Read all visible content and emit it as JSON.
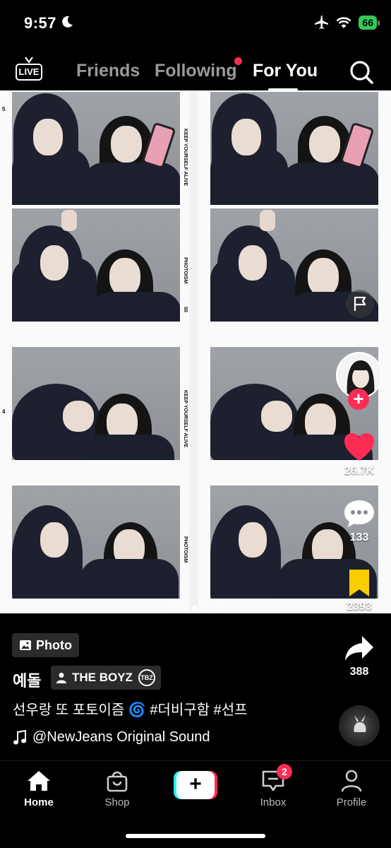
{
  "status_bar": {
    "time": "9:57",
    "battery": "66"
  },
  "top_nav": {
    "live_label": "LIVE",
    "tabs": [
      {
        "label": "Friends"
      },
      {
        "label": "Following"
      },
      {
        "label": "For You"
      }
    ]
  },
  "photo": {
    "strip_texts": [
      "KEEP YOURSELF ALIVE",
      "PHOTOISM",
      "KEEP YOURSELF ALIVE",
      "PHOTOISM"
    ],
    "strip_numbers": [
      "5",
      "50",
      "4"
    ],
    "slide_count": 5,
    "active_slide": 3
  },
  "actions": {
    "likes": "26.7K",
    "comments": "133",
    "saves": "2393",
    "shares": "388"
  },
  "post": {
    "type_badge": "Photo",
    "username": "예돌",
    "group_tag": "THE BOYZ",
    "group_logo": "TBZ",
    "caption": "선우랑 또 포토이즘 🌀 #더비구함 #선프",
    "sound": "@NewJeans Original Sound"
  },
  "bottom_nav": {
    "home": "Home",
    "shop": "Shop",
    "create": "+",
    "inbox": "Inbox",
    "inbox_badge": "2",
    "profile": "Profile"
  },
  "colors": {
    "accent": "#fe2c55",
    "save": "#facd00",
    "battery": "#35c759"
  }
}
